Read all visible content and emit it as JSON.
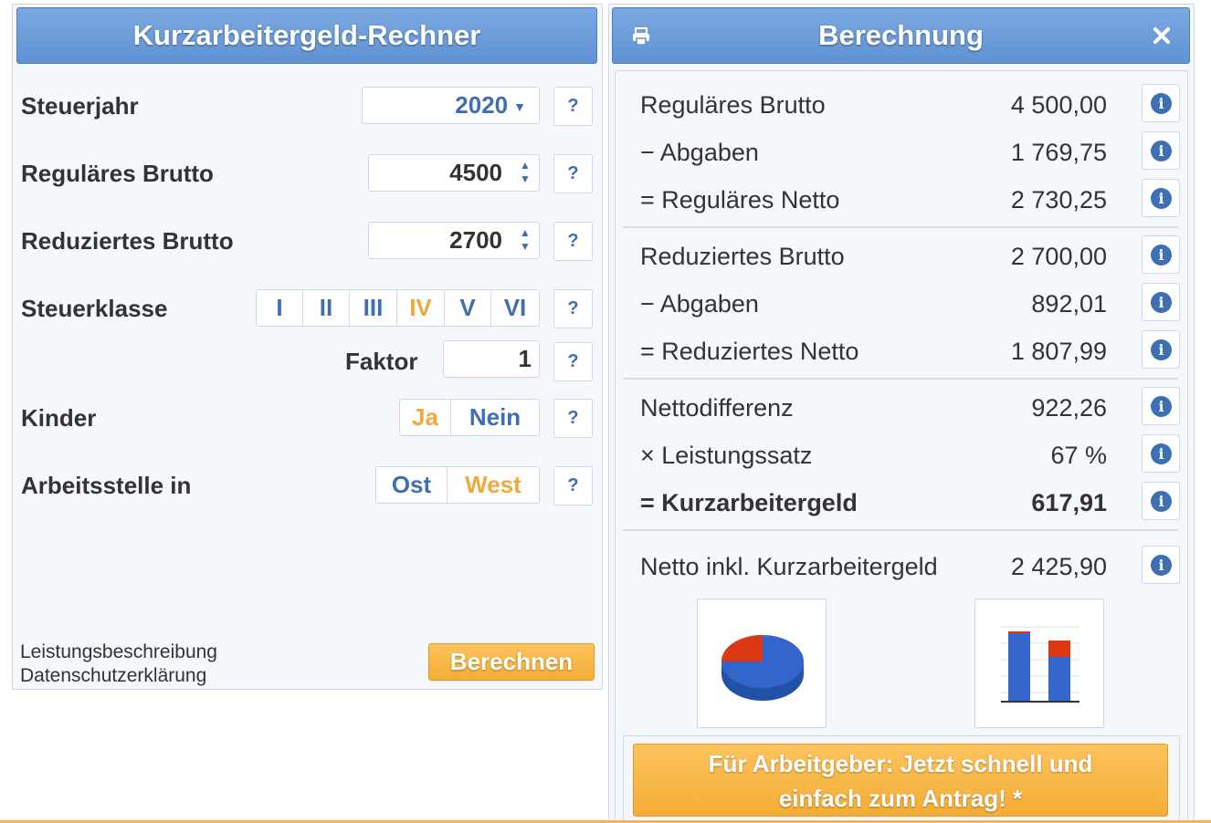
{
  "calculator": {
    "title": "Kurzarbeitergeld-Rechner",
    "help_label": "?",
    "steuerjahr": {
      "label": "Steuerjahr",
      "value": "2020"
    },
    "regulaeres_brutto": {
      "label": "Reguläres Brutto",
      "value": "4500"
    },
    "reduziertes_brutto": {
      "label": "Reduziertes Brutto",
      "value": "2700"
    },
    "steuerklasse": {
      "label": "Steuerklasse",
      "options": [
        "I",
        "II",
        "III",
        "IV",
        "V",
        "VI"
      ],
      "selected": "IV"
    },
    "faktor": {
      "label": "Faktor",
      "value": "1"
    },
    "kinder": {
      "label": "Kinder",
      "options": [
        "Ja",
        "Nein"
      ],
      "selected": "Ja"
    },
    "arbeitsstelle": {
      "label": "Arbeitsstelle in",
      "options": [
        "Ost",
        "West"
      ],
      "selected": "West"
    },
    "links": {
      "leistung": "Leistungsbeschreibung",
      "datenschutz": "Datenschutzerklärung"
    },
    "calculate_label": "Berechnen"
  },
  "result": {
    "title": "Berechnung",
    "icons": {
      "print": "print-icon",
      "close": "close-icon"
    },
    "info_label": "i",
    "rows": [
      {
        "label": "Reguläres Brutto",
        "value": "4 500,00"
      },
      {
        "label": "− Abgaben",
        "value": "1 769,75"
      },
      {
        "label": "= Reguläres Netto",
        "value": "2 730,25"
      },
      {
        "label": "Reduziertes Brutto",
        "value": "2 700,00"
      },
      {
        "label": "− Abgaben",
        "value": "892,01"
      },
      {
        "label": "= Reduziertes Netto",
        "value": "1 807,99"
      },
      {
        "label": "Nettodifferenz",
        "value": "922,26"
      },
      {
        "label": "× Leistungssatz",
        "value": "67 %"
      },
      {
        "label": "= Kurzarbeitergeld",
        "value": "617,91"
      },
      {
        "label": "Netto inkl. Kurzarbeitergeld",
        "value": "2 425,90"
      }
    ],
    "employer_cta": {
      "line1": "Für Arbeitgeber: Jetzt schnell und",
      "line2": "einfach zum Antrag! *"
    }
  },
  "colors": {
    "accent_blue": "#5f92d4",
    "accent_orange": "#f5ad36",
    "chart_blue": "#3366cc",
    "chart_red": "#dc3912"
  }
}
